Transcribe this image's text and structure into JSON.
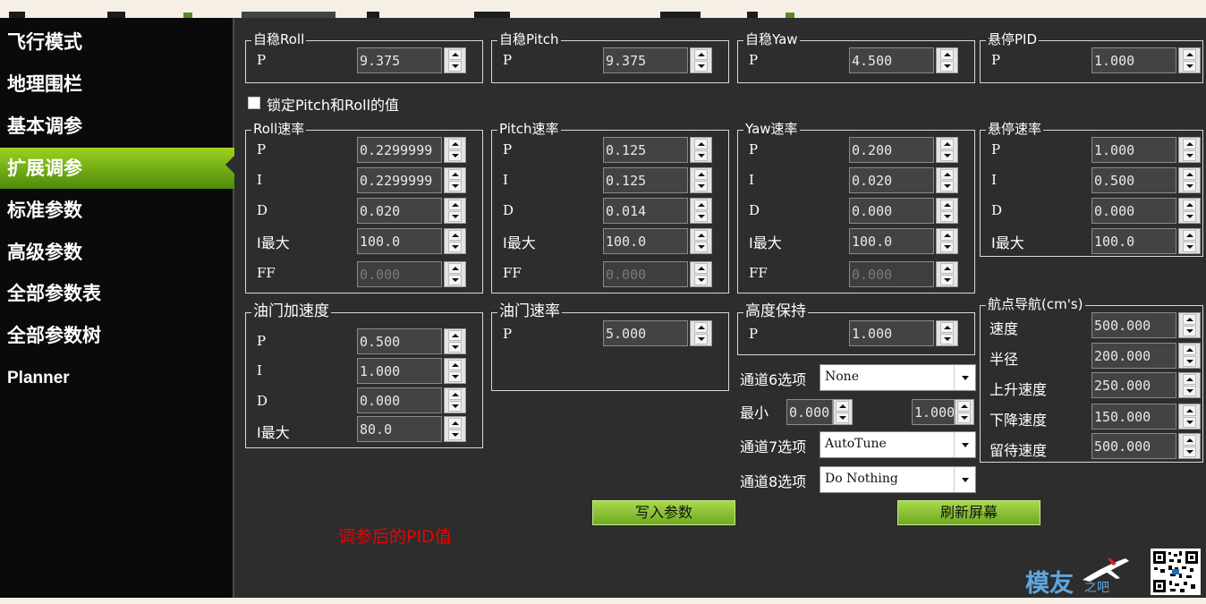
{
  "sidebar": {
    "items": [
      "飞行模式",
      "地理围栏",
      "基本调参",
      "扩展调参",
      "标准参数",
      "高级参数",
      "全部参数表",
      "全部参数树",
      "Planner"
    ],
    "active_index": 3
  },
  "lock_checkbox": {
    "label": "锁定Pitch和Roll的值",
    "checked": false
  },
  "groups": {
    "stab_roll": {
      "title": "自稳Roll",
      "p_label": "P",
      "p": "9.375"
    },
    "stab_pitch": {
      "title": "自稳Pitch",
      "p_label": "P",
      "p": "9.375"
    },
    "stab_yaw": {
      "title": "自稳Yaw",
      "p_label": "P",
      "p": "4.500"
    },
    "loiter_pid": {
      "title": "悬停PID",
      "p_label": "P",
      "p": "1.000"
    },
    "rate_roll": {
      "title": "Roll速率",
      "labels": [
        "P",
        "I",
        "D",
        "I最大",
        "FF"
      ],
      "values": [
        "0.2299999",
        "0.2299999",
        "0.020",
        "100.0",
        "0.000"
      ]
    },
    "rate_pitch": {
      "title": "Pitch速率",
      "labels": [
        "P",
        "I",
        "D",
        "I最大",
        "FF"
      ],
      "values": [
        "0.125",
        "0.125",
        "0.014",
        "100.0",
        "0.000"
      ]
    },
    "rate_yaw": {
      "title": "Yaw速率",
      "labels": [
        "P",
        "I",
        "D",
        "I最大",
        "FF"
      ],
      "values": [
        "0.200",
        "0.020",
        "0.000",
        "100.0",
        "0.000"
      ]
    },
    "loiter_rate": {
      "title": "悬停速率",
      "labels": [
        "P",
        "I",
        "D",
        "I最大"
      ],
      "values": [
        "1.000",
        "0.500",
        "0.000",
        "100.0"
      ]
    },
    "throttle_accel": {
      "title": "油门加速度",
      "labels": [
        "P",
        "I",
        "D",
        "I最大"
      ],
      "values": [
        "0.500",
        "1.000",
        "0.000",
        "80.0"
      ]
    },
    "throttle_rate": {
      "title": "油门速率",
      "p_label": "P",
      "p": "5.000"
    },
    "alt_hold": {
      "title": "高度保持",
      "p_label": "P",
      "p": "1.000"
    },
    "wpnav": {
      "title": "航点导航(cm's)",
      "labels": [
        "速度",
        "半径",
        "上升速度",
        "下降速度",
        "留待速度"
      ],
      "values": [
        "500.000",
        "200.000",
        "250.000",
        "150.000",
        "500.000"
      ]
    }
  },
  "channels": {
    "ch6_label": "通道6选项",
    "ch6_value": "None",
    "min_label": "最小",
    "min_value": "0.000",
    "max_value": "1.000",
    "ch7_label": "通道7选项",
    "ch7_value": "AutoTune",
    "ch8_label": "通道8选项",
    "ch8_value": "Do Nothing"
  },
  "buttons": {
    "write": "写入参数",
    "refresh": "刷新屏幕"
  },
  "annotation": "调参后的PID值",
  "watermark": {
    "logo_text": "模友",
    "logo_suffix": "之吧"
  },
  "colors": {
    "accent": "#7fb81a",
    "panel": "#2d2d2d",
    "annotation": "#ee0000"
  }
}
